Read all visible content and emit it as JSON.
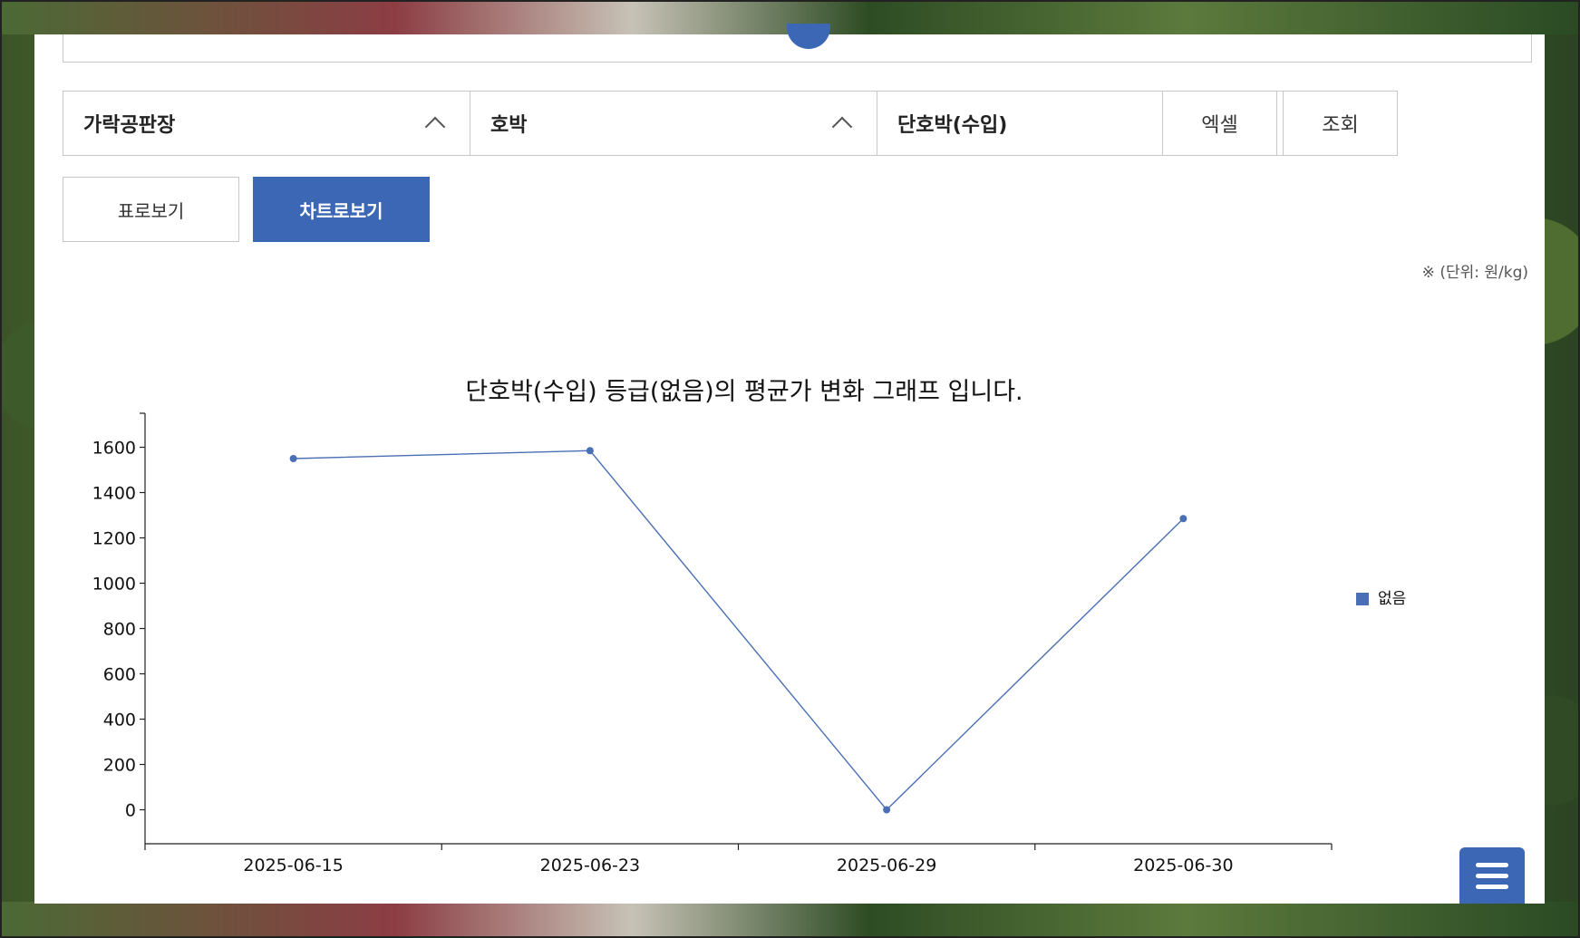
{
  "filters": {
    "market": "가락공판장",
    "item": "호박",
    "variety": "단호박(수입)",
    "excel_label": "엑셀",
    "search_label": "조회"
  },
  "view_toggle": {
    "table_label": "표로보기",
    "chart_label": "차트로보기",
    "active": "chart"
  },
  "unit_note": "※ (단위: 원/kg)",
  "colors": {
    "accent": "#3b67b5",
    "series": "#4a6fb5"
  },
  "chart_data": {
    "type": "line",
    "title": "단호박(수입) 등급(없음)의 평균가 변화 그래프 입니다.",
    "categories": [
      "2025-06-15",
      "2025-06-23",
      "2025-06-29",
      "2025-06-30"
    ],
    "series": [
      {
        "name": "없음",
        "values": [
          1550,
          1585,
          0,
          1285
        ]
      }
    ],
    "yticks": [
      0,
      200,
      400,
      600,
      800,
      1000,
      1200,
      1400,
      1600
    ],
    "ylim": [
      -150,
      1750
    ],
    "grid": false,
    "legend": "right"
  }
}
